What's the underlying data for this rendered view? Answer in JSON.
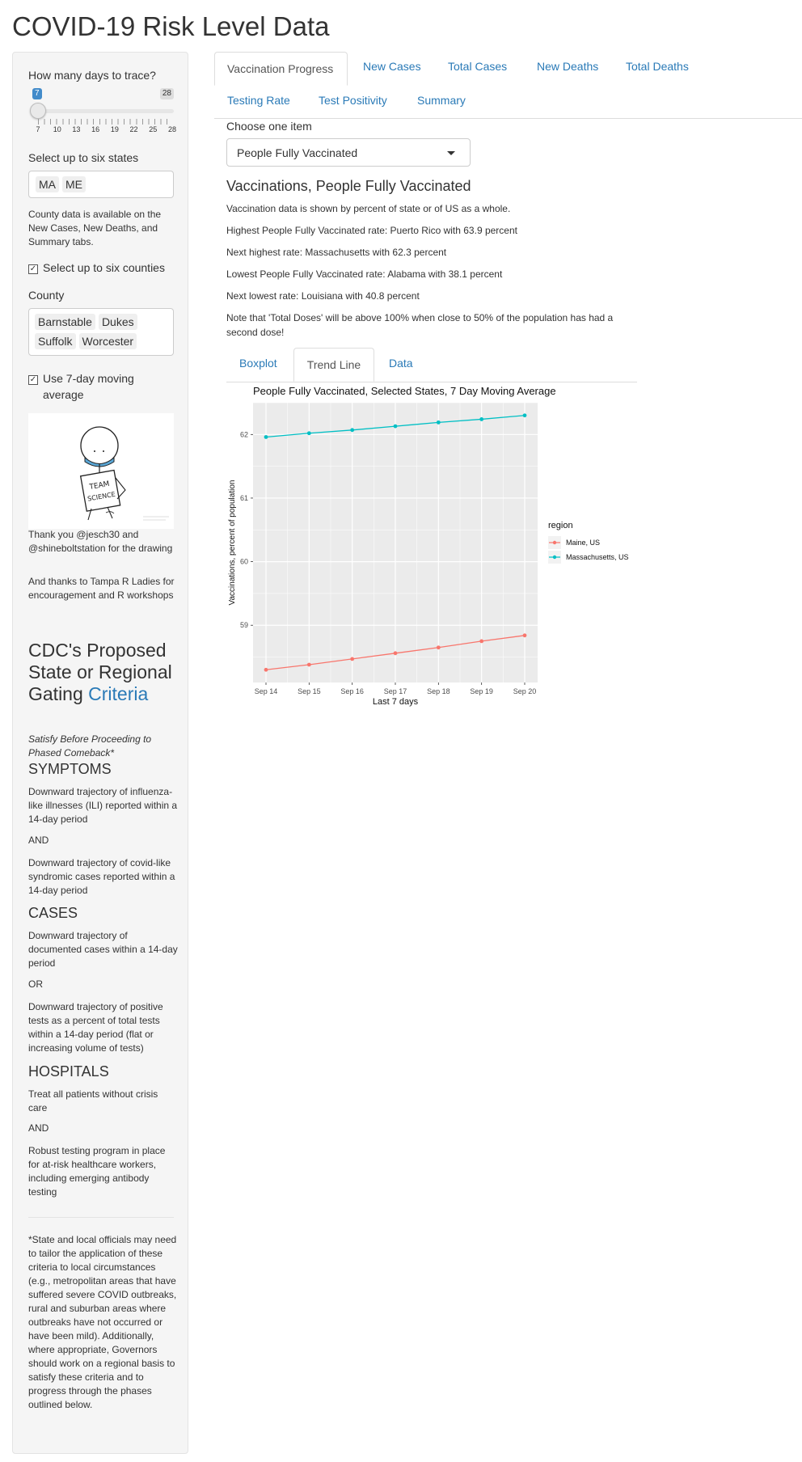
{
  "app": {
    "title": "COVID-19 Risk Level Data"
  },
  "sidebar": {
    "days_label": "How many days to trace?",
    "slider": {
      "min_badge": "7",
      "max_badge": "28",
      "value": 7,
      "min": 7,
      "max": 28,
      "tick_labels": [
        "7",
        "10",
        "13",
        "16",
        "19",
        "22",
        "25",
        "28"
      ]
    },
    "states_label": "Select up to six states",
    "states": [
      "MA",
      "ME"
    ],
    "county_note": "County data is available on the New Cases, New Deaths, and Summary tabs.",
    "counties_checkbox": {
      "label": "Select up to six counties",
      "checked": true,
      "mark": "✓"
    },
    "county_label": "County",
    "counties": [
      "Barnstable",
      "Dukes",
      "Suffolk",
      "Worcester"
    ],
    "moving_avg_checkbox": {
      "label": "Use 7-day moving average",
      "checked": true,
      "mark": "✓"
    },
    "drawing": {
      "sign_line1": "TEAM",
      "sign_line2": "SCIENCE"
    },
    "thanks1": "Thank you @jesch30 and @shineboltstation for the drawing",
    "thanks2": "And thanks to Tampa R Ladies for encouragement and R workshops",
    "cdc_heading": "CDC's Proposed State or Regional Gating",
    "cdc_link": "Criteria",
    "cdc_sub": "Satisfy Before Proceeding to Phased Comeback*",
    "symptoms_head": "SYMPTOMS",
    "symptoms_1": "Downward trajectory of influenza-like illnesses (ILI) reported within a 14-day period",
    "and_1": "AND",
    "symptoms_2": "Downward trajectory of covid-like syndromic cases reported within a 14-day period",
    "cases_head": "CASES",
    "cases_1": "Downward trajectory of documented cases within a 14-day period",
    "or_1": "OR",
    "cases_2": "Downward trajectory of positive tests as a percent of total tests within a 14-day period (flat or increasing volume of tests)",
    "hospitals_head": "HOSPITALS",
    "hospitals_1": "Treat all patients without crisis care",
    "and_2": "AND",
    "hospitals_2": "Robust testing program in place for at-risk healthcare workers, including emerging antibody testing",
    "footnote": "*State and local officials may need to tailor the application of these criteria to local circumstances (e.g., metropolitan areas that have suffered severe COVID outbreaks, rural and suburban areas where outbreaks have not occurred or have been mild). Additionally, where appropriate, Governors should work on a regional basis to satisfy these criteria and to progress through the phases outlined below."
  },
  "tabs": {
    "row1": [
      "Vaccination Progress",
      "New Cases",
      "Total Cases",
      "New Deaths",
      "Total Deaths"
    ],
    "row2": [
      "Testing Rate",
      "Test Positivity",
      "Summary"
    ],
    "active": "Vaccination Progress"
  },
  "main": {
    "choose_label": "Choose one item",
    "dropdown_value": "People Fully Vaccinated",
    "viz_title": "Vaccinations, People Fully Vaccinated",
    "p1": "Vaccination data is shown by percent of state or of US as a whole.",
    "p2": "Highest People Fully Vaccinated rate: Puerto Rico with 63.9 percent",
    "p3": "Next highest rate: Massachusetts with 62.3 percent",
    "p4": "Lowest People Fully Vaccinated rate: Alabama with 38.1 percent",
    "p5": "Next lowest rate: Louisiana with 40.8 percent",
    "p6": "Note that 'Total Doses' will be above 100% when close to 50% of the population has had a second dose!",
    "subtabs": [
      "Boxplot",
      "Trend Line",
      "Data"
    ],
    "active_subtab": "Trend Line"
  },
  "chart_data": {
    "type": "line",
    "title": "People Fully Vaccinated, Selected States, 7 Day Moving Average",
    "xlabel": "Last 7 days",
    "ylabel": "Vaccinations, percent of population",
    "categories": [
      "Sep 14",
      "Sep 15",
      "Sep 16",
      "Sep 17",
      "Sep 18",
      "Sep 19",
      "Sep 20"
    ],
    "y_ticks": [
      59,
      60,
      61,
      62
    ],
    "ylim": [
      58.1,
      62.5
    ],
    "grid": true,
    "legend_title": "region",
    "legend_position": "right",
    "series": [
      {
        "name": "Maine, US",
        "color": "#F8766D",
        "values": [
          58.3,
          58.38,
          58.47,
          58.56,
          58.65,
          58.75,
          58.84
        ]
      },
      {
        "name": "Massachusetts, US",
        "color": "#00BFC4",
        "values": [
          61.96,
          62.02,
          62.07,
          62.13,
          62.19,
          62.24,
          62.3
        ]
      }
    ]
  }
}
